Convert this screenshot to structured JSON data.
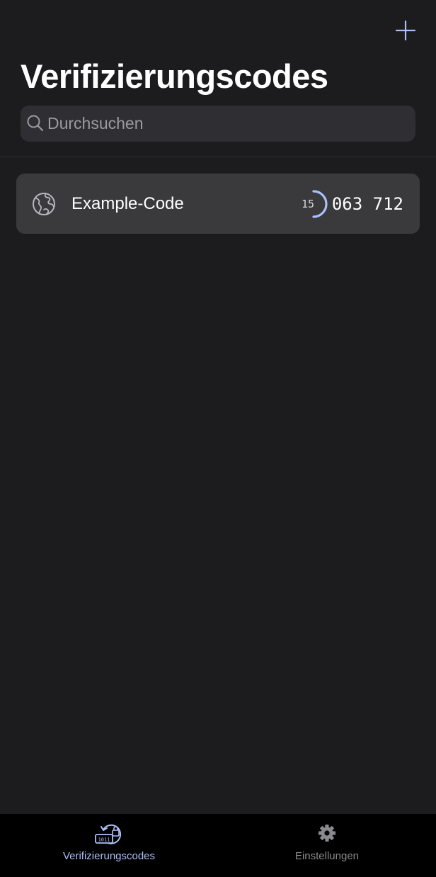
{
  "header": {
    "add_icon": "plus-icon",
    "title": "Verifizierungscodes"
  },
  "search": {
    "icon": "search-icon",
    "placeholder": "Durchsuchen",
    "value": ""
  },
  "codes": [
    {
      "icon": "globe-icon",
      "name": "Example-Code",
      "seconds_remaining": "15",
      "timer_fraction": 0.5,
      "code": "063 712"
    }
  ],
  "tab_bar": {
    "tabs": [
      {
        "label": "Verifizierungscodes",
        "icon": "codes-icon",
        "selected": true
      },
      {
        "label": "Einstellungen",
        "icon": "gear-icon",
        "selected": false
      }
    ]
  },
  "colors": {
    "background": "#1c1c1e",
    "accent": "#a9c0f8",
    "row_background": "#3a3a3d",
    "search_background": "#2f2f33",
    "tab_bar_background": "#000000",
    "inactive_tab": "#8a8a8e"
  }
}
